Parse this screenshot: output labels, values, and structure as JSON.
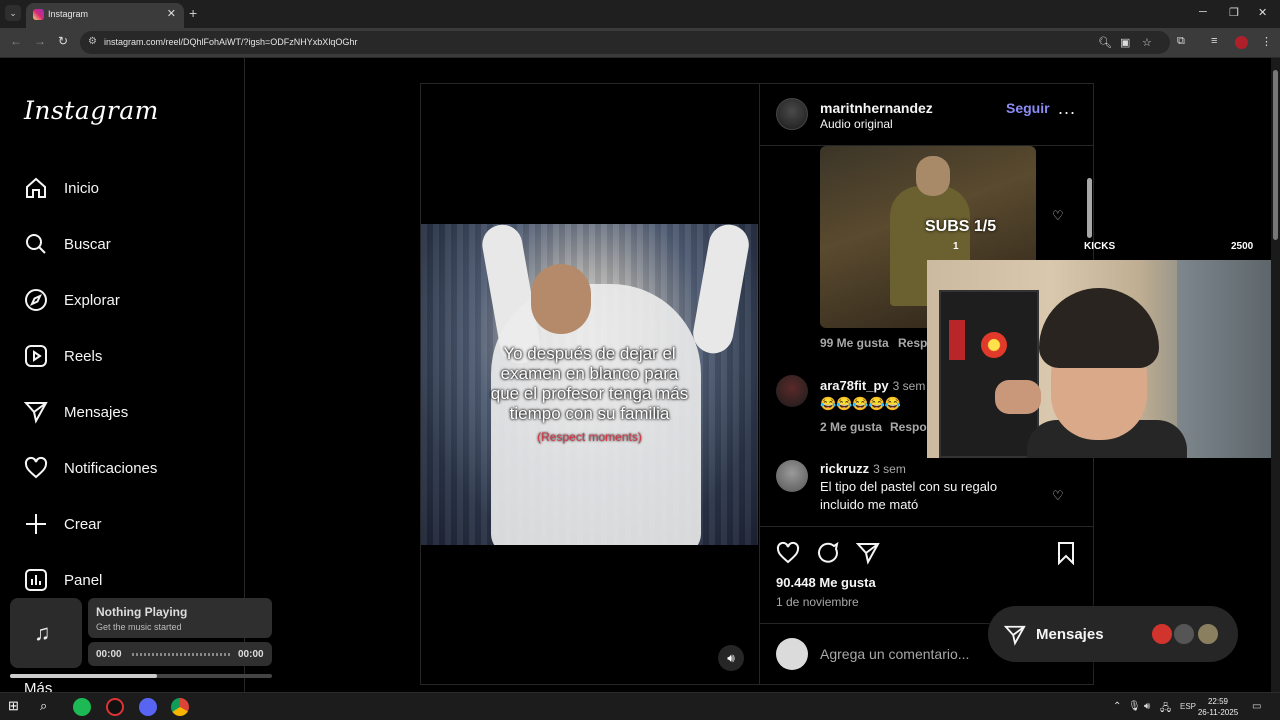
{
  "browser": {
    "tab_title": "Instagram",
    "url": "instagram.com/reel/DQhlFohAiWT/?igsh=ODFzNHYxbXlqOGhr",
    "new_tab": "+",
    "tab_close": "✕",
    "tab_list": "⌄"
  },
  "sidebar": {
    "logo": "Instagram",
    "items": [
      {
        "label": "Inicio",
        "icon": "home-icon"
      },
      {
        "label": "Buscar",
        "icon": "search-icon"
      },
      {
        "label": "Explorar",
        "icon": "compass-icon"
      },
      {
        "label": "Reels",
        "icon": "reels-icon"
      },
      {
        "label": "Mensajes",
        "icon": "send-icon"
      },
      {
        "label": "Notificaciones",
        "icon": "heart-icon"
      },
      {
        "label": "Crear",
        "icon": "plus-icon"
      },
      {
        "label": "Panel",
        "icon": "chart-icon"
      }
    ],
    "more_label": "Más"
  },
  "video": {
    "caption_line1": "Yo después de dejar el",
    "caption_line2": "examen en blanco para",
    "caption_line3": "que el profesor tenga más",
    "caption_line4": "tiempo con su familia",
    "caption_sub": "(Respect moments)"
  },
  "post": {
    "username": "maritnhernandez",
    "audio": "Audio original",
    "follow_label": "Seguir",
    "more": "...",
    "likes": "90.448 Me gusta",
    "date": "1 de noviembre",
    "comment_placeholder": "Agrega un comentario..."
  },
  "comments": [
    {
      "likes": "99 Me gusta",
      "reply": "Respo"
    },
    {
      "user": "ara78fit_py",
      "time": "3 sem",
      "text": "😂😂😂😂😂",
      "likes": "2 Me gusta",
      "reply": "Respo"
    },
    {
      "user": "rickruzz",
      "time": "3 sem",
      "text_line1": "El tipo del pastel con su regalo",
      "text_line2": "incluido me mató"
    }
  ],
  "overlay": {
    "subs": "SUBS 1/5",
    "subs_count": "1",
    "kicks": "KICKS",
    "kicks_count": "2500"
  },
  "messages_pill": {
    "label": "Mensajes"
  },
  "music_widget": {
    "title": "Nothing Playing",
    "subtitle": "Get the music started",
    "time_start": "00:00",
    "time_end": "00:00",
    "progress": 0.56
  },
  "taskbar": {
    "lang": "ESP",
    "time": "22:59",
    "date": "26-11-2025"
  },
  "colors": {
    "follow": "#8c8cf5",
    "caption_sub": "#d23a4a",
    "background": "#000000"
  }
}
